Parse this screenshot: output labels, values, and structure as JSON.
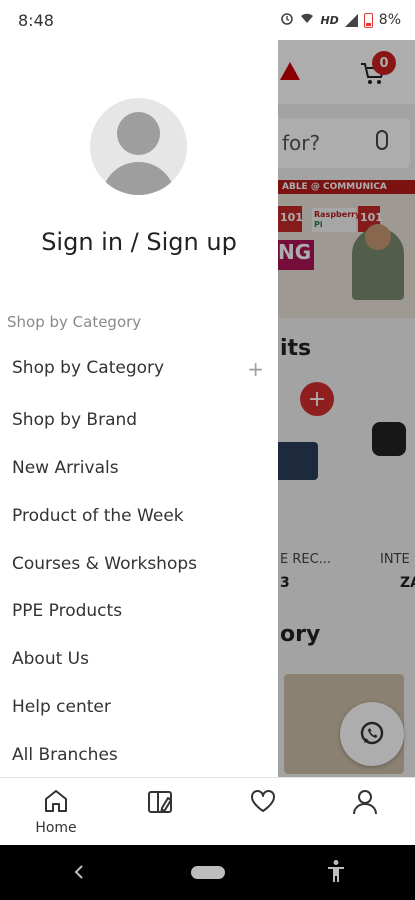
{
  "status_bar": {
    "time": "8:48",
    "network": "HD",
    "battery": "8%"
  },
  "background": {
    "cart_count": "0",
    "search_fragment": "for?",
    "banner_fragment": "ABLE @ COMMUNICA",
    "banner_tag_1": "101",
    "banner_tag_2": "Raspberry",
    "banner_tag_3": "Pi",
    "banner_tag_4": "101",
    "banner_tag_5": "NG",
    "section_1_fragment": "its",
    "section_2_fragment": "ory",
    "product_1_name_fragment": "E REC...",
    "product_1_price_fragment": "3",
    "product_2_name_fragment": "INTE",
    "product_2_price_fragment": "ZA"
  },
  "drawer": {
    "signin_text": "Sign in / Sign up",
    "section_header": "Shop by Category",
    "items": [
      {
        "label": "Shop by Category",
        "expandable": "+"
      },
      {
        "label": "Shop by Brand"
      },
      {
        "label": "New Arrivals"
      },
      {
        "label": "Product of the Week"
      },
      {
        "label": "Courses & Workshops"
      },
      {
        "label": "PPE Products"
      },
      {
        "label": "About Us"
      },
      {
        "label": "Help center"
      },
      {
        "label": "All Branches"
      }
    ]
  },
  "bottom_nav": {
    "home_label": "Home"
  },
  "colors": {
    "accent": "#cc1f1f",
    "scrim": "#000000",
    "muted_text": "#8a8a8a"
  }
}
